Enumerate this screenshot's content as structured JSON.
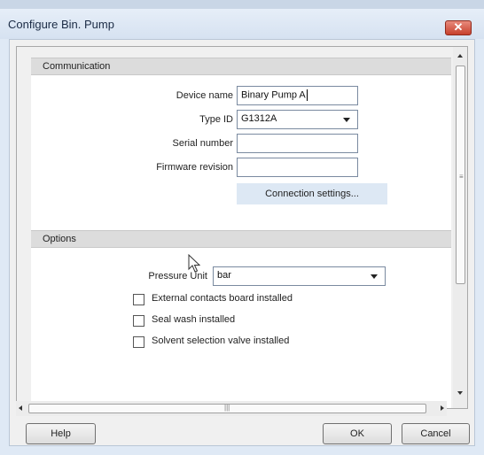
{
  "window": {
    "title": "Configure Bin. Pump"
  },
  "communication": {
    "section_title": "Communication",
    "device_name_label": "Device name",
    "device_name_value": "Binary Pump A",
    "type_id_label": "Type ID",
    "type_id_value": "G1312A",
    "serial_number_label": "Serial number",
    "serial_number_value": "",
    "firmware_revision_label": "Firmware revision",
    "firmware_revision_value": "",
    "connection_settings_label": "Connection settings..."
  },
  "options": {
    "section_title": "Options",
    "pressure_unit_label": "Pressure Unit",
    "pressure_unit_value": "bar",
    "checkboxes": [
      {
        "label": "External contacts board installed",
        "checked": false
      },
      {
        "label": "Seal wash installed",
        "checked": false
      },
      {
        "label": "Solvent selection valve installed",
        "checked": false
      }
    ]
  },
  "buttons": {
    "help": "Help",
    "ok": "OK",
    "cancel": "Cancel"
  },
  "icons": {
    "close": "close-icon",
    "cursor": "mouse-pointer-icon"
  }
}
